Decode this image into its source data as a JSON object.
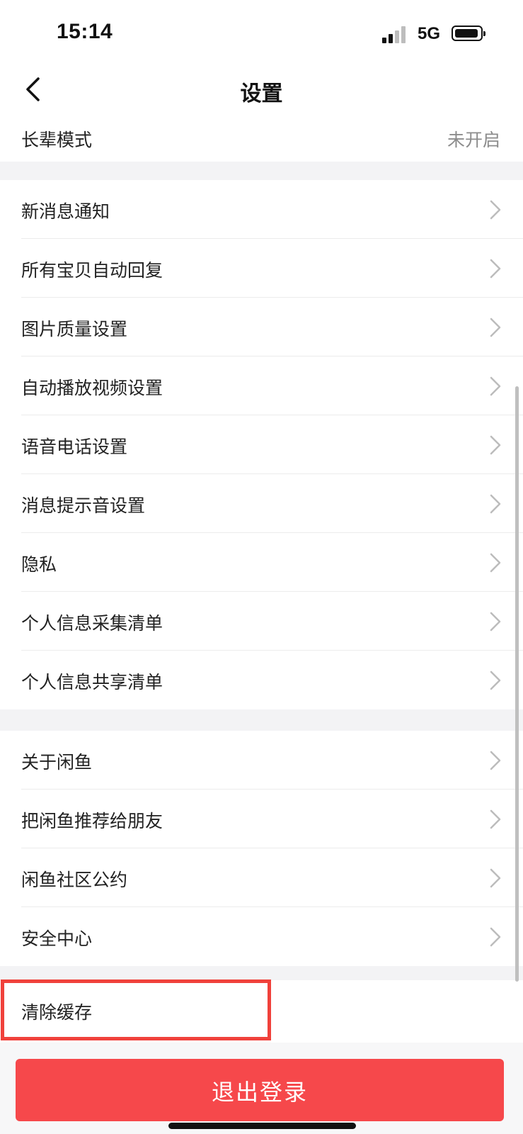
{
  "status_bar": {
    "time": "15:14",
    "network": "5G"
  },
  "header": {
    "title": "设置"
  },
  "elder_mode": {
    "label": "长辈模式",
    "value": "未开启"
  },
  "group1": [
    {
      "label": "新消息通知"
    },
    {
      "label": "所有宝贝自动回复"
    },
    {
      "label": "图片质量设置"
    },
    {
      "label": "自动播放视频设置"
    },
    {
      "label": "语音电话设置"
    },
    {
      "label": "消息提示音设置"
    },
    {
      "label": "隐私"
    },
    {
      "label": "个人信息采集清单"
    },
    {
      "label": "个人信息共享清单"
    }
  ],
  "group2": [
    {
      "label": "关于闲鱼"
    },
    {
      "label": "把闲鱼推荐给朋友"
    },
    {
      "label": "闲鱼社区公约"
    },
    {
      "label": "安全中心"
    }
  ],
  "clear_cache": {
    "label": "清除缓存"
  },
  "logout": {
    "label": "退出登录"
  },
  "colors": {
    "accent": "#f6484b",
    "highlight": "#f0413b"
  },
  "icons": [
    "signal-icon",
    "battery-icon",
    "back-arrow-icon",
    "chevron-right-icon"
  ]
}
